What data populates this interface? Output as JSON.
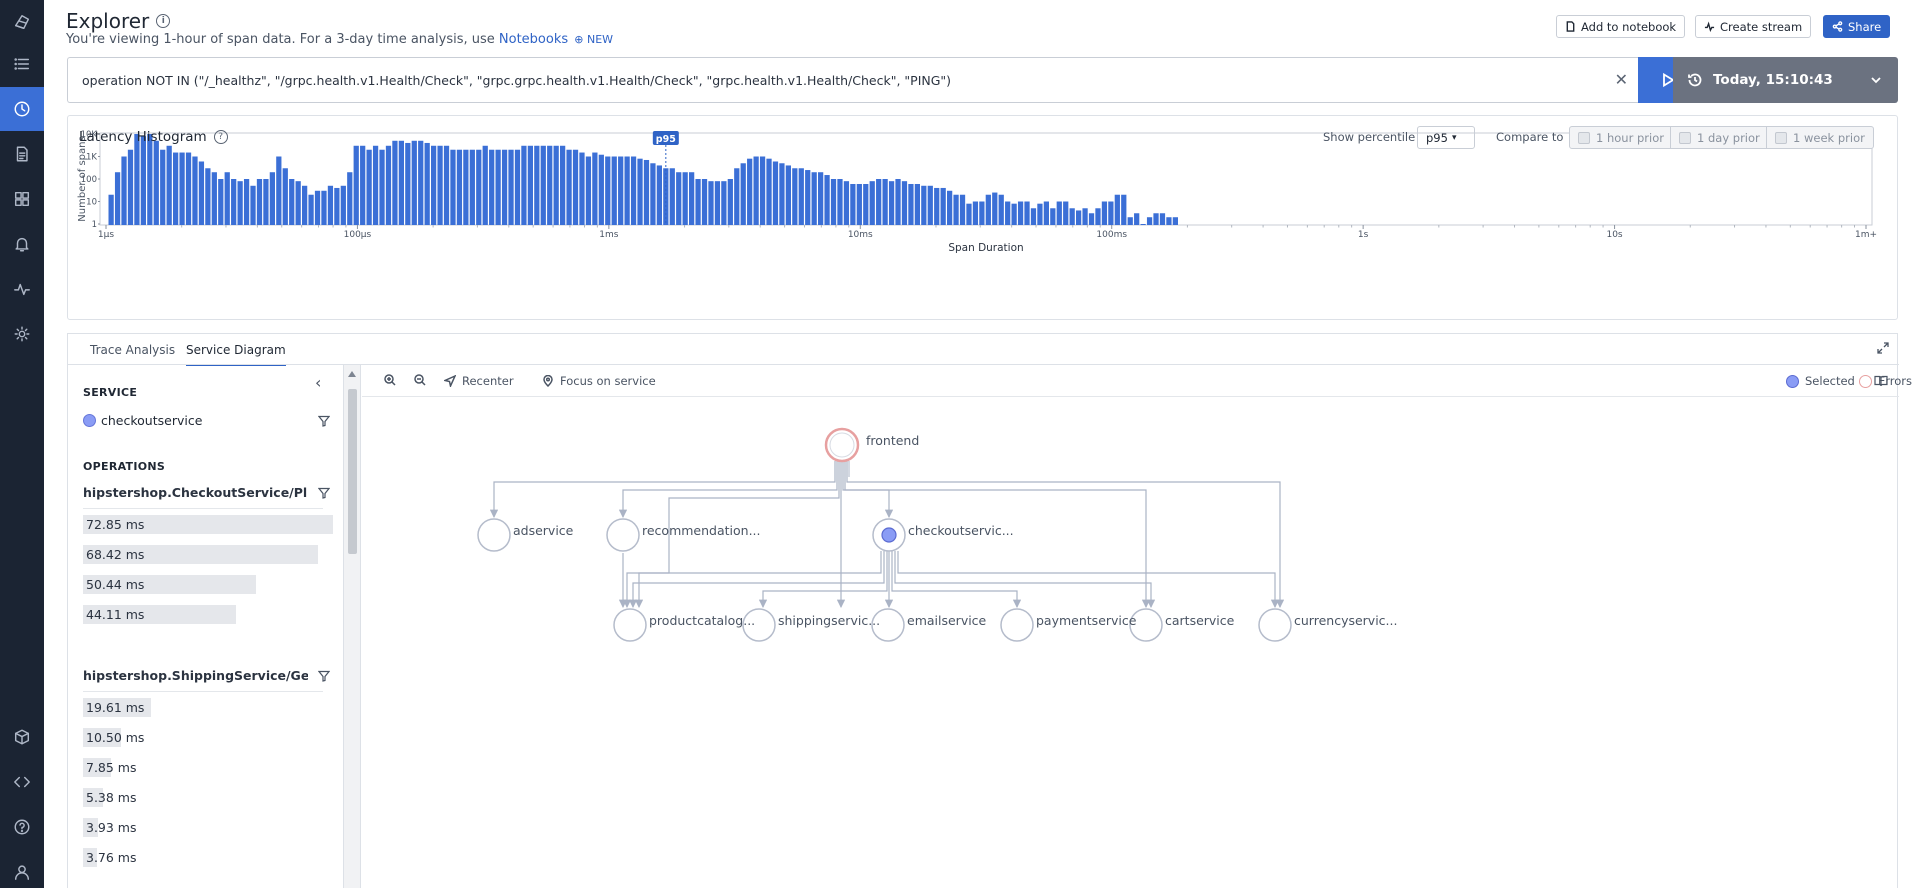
{
  "header": {
    "title": "Explorer",
    "subtitle_prefix": "You're viewing 1-hour of span data. For a 3-day time analysis, use",
    "notebooks_link": "Notebooks",
    "new_badge": "NEW",
    "add_to_notebook": "Add to notebook",
    "create_stream": "Create stream",
    "share": "Share"
  },
  "query": {
    "text": "operation NOT IN (\"/_healthz\", \"/grpc.health.v1.Health/Check\", \"grpc.grpc.health.v1.Health/Check\", \"grpc.health.v1.Health/Check\", \"PING\")",
    "time_label": "Today, 15:10:43"
  },
  "histogram": {
    "title": "Latency Histogram",
    "show_percentile_label": "Show percentile",
    "percentile_value": "p95",
    "compare_label": "Compare to",
    "compare_options": [
      "1 hour prior",
      "1 day prior",
      "1 week prior"
    ]
  },
  "chart_data": {
    "type": "bar",
    "xlabel": "Span Duration",
    "ylabel": "Number of spans",
    "y_scale": "log",
    "y_ticks": [
      "10K",
      "1K",
      "100",
      "10",
      "1"
    ],
    "x_ticks": [
      "1μs",
      "100μs",
      "1ms",
      "10ms",
      "100ms",
      "1s",
      "10s",
      "1m+"
    ],
    "marker": {
      "label": "p95",
      "bin": 86
    },
    "values": [
      20,
      200,
      1000,
      2000,
      10000,
      8000,
      10000,
      5000,
      2000,
      3000,
      1500,
      1500,
      1500,
      1000,
      600,
      300,
      200,
      100,
      200,
      100,
      80,
      100,
      50,
      100,
      100,
      200,
      1000,
      300,
      100,
      80,
      50,
      20,
      30,
      30,
      50,
      40,
      50,
      200,
      3000,
      3000,
      2000,
      3000,
      2000,
      3000,
      5000,
      5000,
      4000,
      5000,
      5000,
      4000,
      3000,
      3000,
      3000,
      2000,
      2000,
      2000,
      2000,
      2000,
      3000,
      2000,
      2000,
      2000,
      2000,
      2000,
      3000,
      3000,
      3000,
      3000,
      3000,
      3000,
      3000,
      2000,
      2000,
      1500,
      1000,
      1500,
      1200,
      1000,
      1000,
      1000,
      1000,
      1000,
      800,
      700,
      500,
      400,
      300,
      300,
      200,
      200,
      200,
      100,
      100,
      80,
      80,
      80,
      100,
      300,
      500,
      800,
      1000,
      1000,
      800,
      600,
      500,
      400,
      300,
      300,
      250,
      200,
      200,
      150,
      100,
      100,
      80,
      60,
      60,
      60,
      80,
      100,
      100,
      80,
      100,
      80,
      60,
      60,
      50,
      50,
      40,
      40,
      30,
      20,
      20,
      8,
      10,
      10,
      20,
      25,
      20,
      10,
      8,
      10,
      10,
      5,
      8,
      10,
      5,
      10,
      10,
      5,
      4,
      5,
      3,
      5,
      10,
      10,
      20,
      20,
      2,
      3,
      1,
      2,
      3,
      3,
      2,
      2
    ]
  },
  "tabs": [
    "Trace Analysis",
    "Service Diagram"
  ],
  "side": {
    "service_title": "SERVICE",
    "service_name": "checkoutservice",
    "operations_title": "OPERATIONS",
    "operations": [
      {
        "name": "hipstershop.CheckoutService/Pl...",
        "latencies": [
          {
            "label": "72.85 ms",
            "frac": 1.0
          },
          {
            "label": "68.42 ms",
            "frac": 0.94
          },
          {
            "label": "50.44 ms",
            "frac": 0.69
          },
          {
            "label": "44.11 ms",
            "frac": 0.61
          }
        ]
      },
      {
        "name": "hipstershop.ShippingService/Ge...",
        "latencies": [
          {
            "label": "19.61 ms",
            "frac": 0.27
          },
          {
            "label": "10.50 ms",
            "frac": 0.15
          },
          {
            "label": "7.85 ms",
            "frac": 0.11
          },
          {
            "label": "5.38 ms",
            "frac": 0.08
          },
          {
            "label": "3.93 ms",
            "frac": 0.06
          },
          {
            "label": "3.76 ms",
            "frac": 0.05
          }
        ]
      }
    ]
  },
  "diagram": {
    "tools": {
      "zoom_in": "",
      "zoom_out": "",
      "recenter": "Recenter",
      "focus": "Focus on service"
    },
    "legend": {
      "selected": "Selected",
      "errors": "Errors"
    },
    "nodes": {
      "frontend": "frontend",
      "adservice": "adservice",
      "recommendation": "recommendation...",
      "checkout": "checkoutservic...",
      "productcatalog": "productcatalog...",
      "shipping": "shippingservic...",
      "email": "emailservice",
      "payment": "paymentservice",
      "cart": "cartservice",
      "currency": "currencyservic..."
    }
  },
  "colors": {
    "accent": "#2f63c6",
    "bar": "#3b6fd6",
    "rail": "#1b2433",
    "selected": "#8a9cf5",
    "error": "#e7a0a0"
  }
}
